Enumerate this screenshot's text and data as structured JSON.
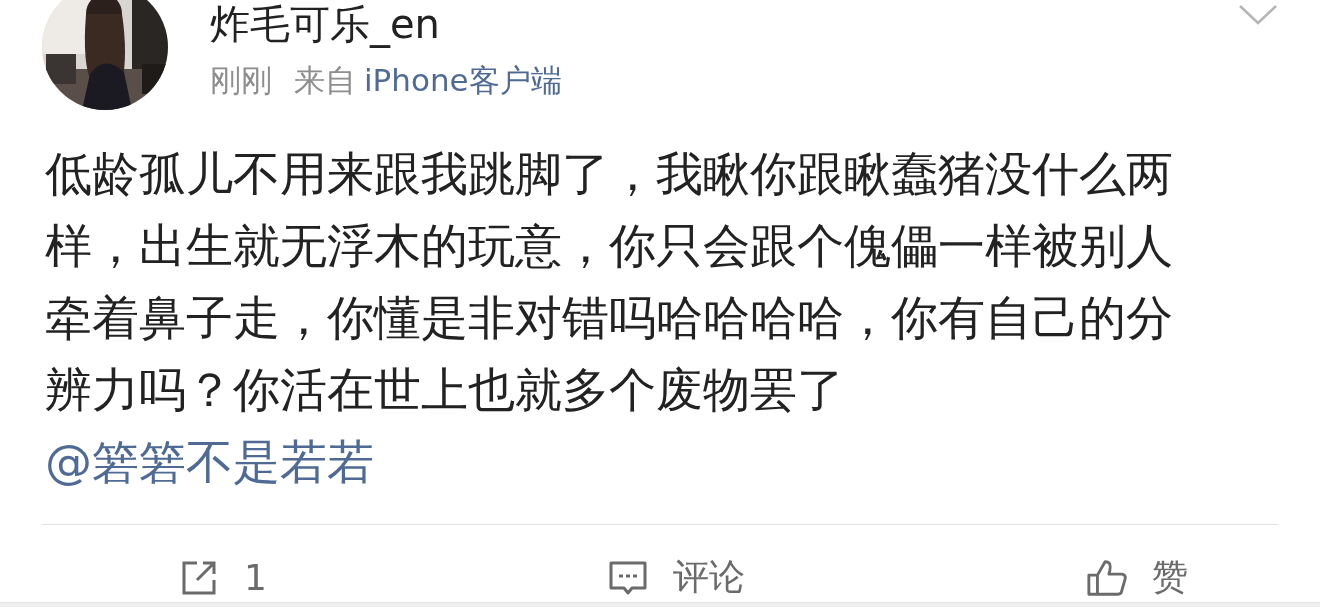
{
  "post": {
    "author": "炸毛可乐_en",
    "time": "刚刚",
    "source_prefix": "来自",
    "source": "iPhone客户端",
    "text": "低龄孤儿不用来跟我跳脚了，我瞅你跟瞅蠢猪没什么两样，出生就无浮木的玩意，你只会跟个傀儡一样被别人牵着鼻子走，你懂是非对错吗哈哈哈哈，你有自己的分辨力吗？你活在世上也就多个废物罢了",
    "mention": "@箬箬不是若若"
  },
  "actions": [
    {
      "kind": "repost",
      "label": "1"
    },
    {
      "kind": "comment",
      "label": "评论"
    },
    {
      "kind": "like",
      "label": "赞"
    }
  ]
}
